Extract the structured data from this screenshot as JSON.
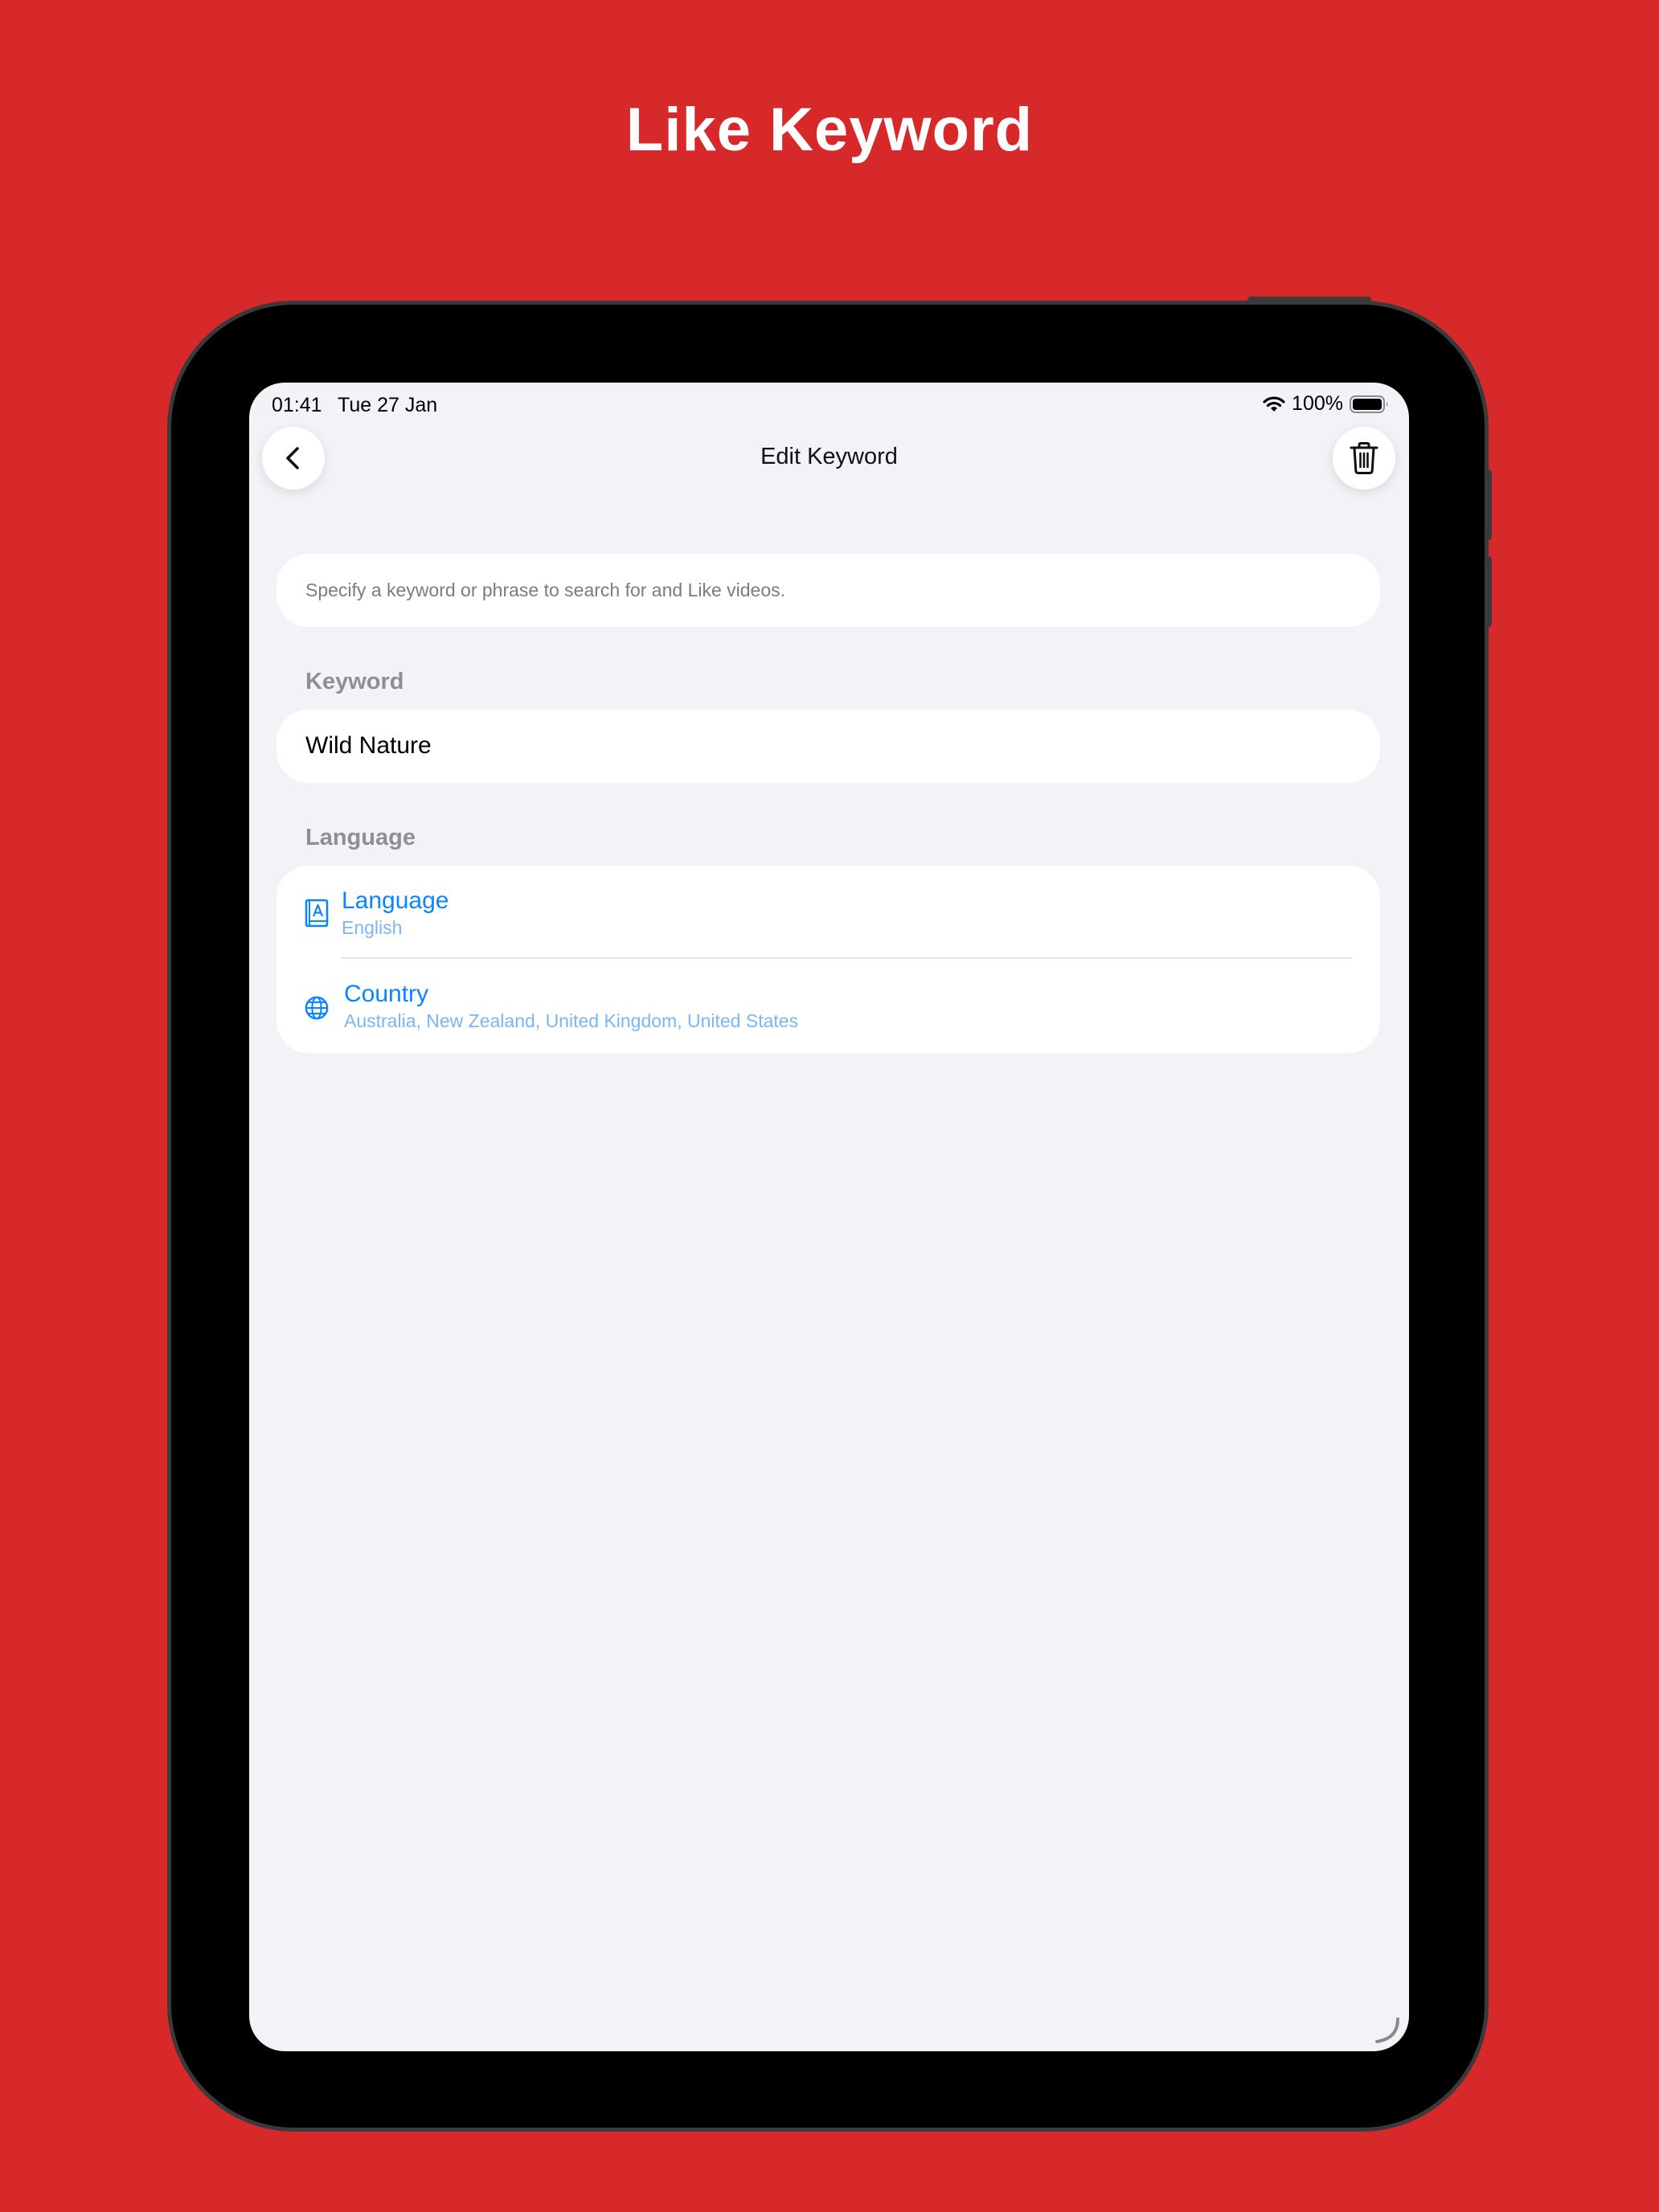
{
  "colors": {
    "background": "#d8292a",
    "screen_bg": "#f2f2f7",
    "accent": "#0a84ff",
    "accent_light": "#7ab6f0",
    "label_gray": "#8e8e93"
  },
  "promo": {
    "headline": "Like Keyword"
  },
  "status_bar": {
    "time": "01:41",
    "date": "Tue 27 Jan",
    "battery_text": "100%",
    "icons": [
      "wifi-icon",
      "battery-icon"
    ]
  },
  "nav": {
    "title": "Edit Keyword",
    "back_icon": "chevron-left-icon",
    "delete_icon": "trash-icon"
  },
  "hint": {
    "text": "Specify a keyword or phrase to search for and Like videos."
  },
  "keyword_section": {
    "label": "Keyword",
    "value": "Wild Nature"
  },
  "language_section": {
    "label": "Language",
    "rows": [
      {
        "icon": "book-icon",
        "title": "Language",
        "subtitle": "English"
      },
      {
        "icon": "globe-icon",
        "title": "Country",
        "subtitle": "Australia, New Zealand, United Kingdom, United States"
      }
    ]
  }
}
